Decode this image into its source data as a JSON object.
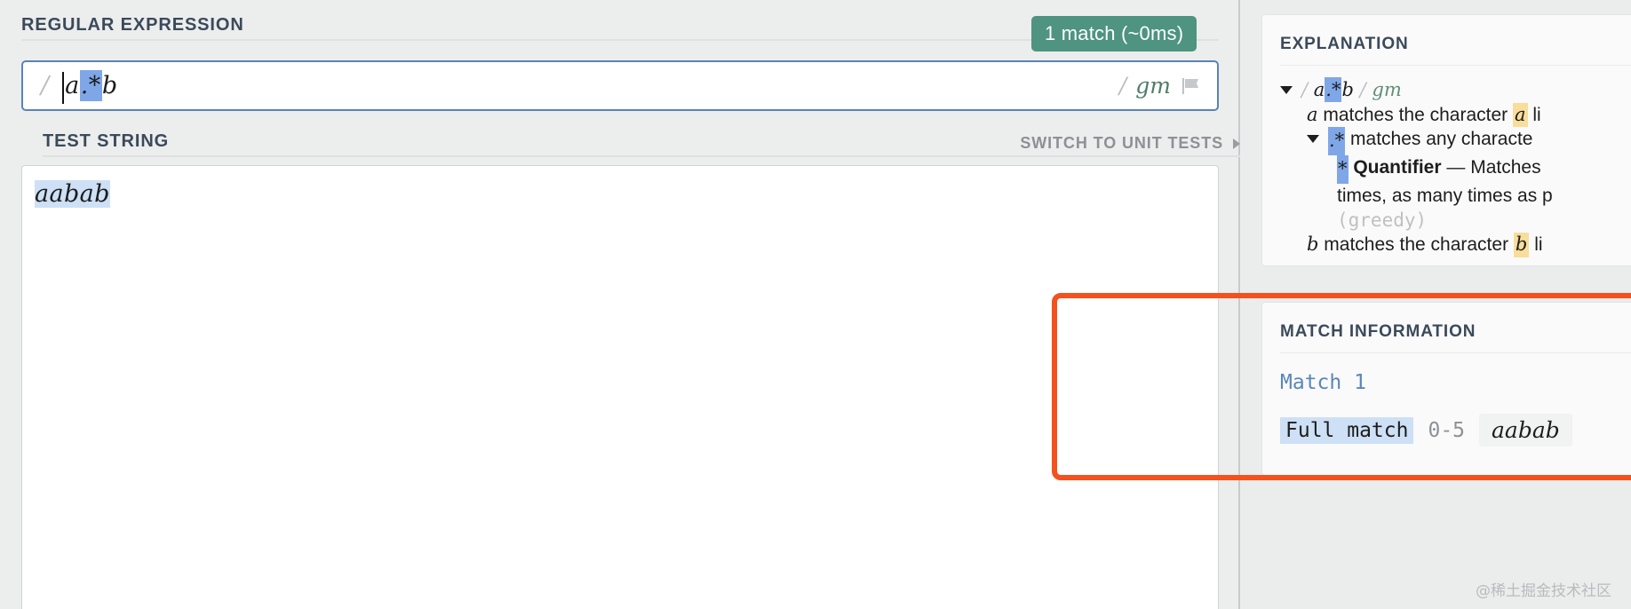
{
  "left": {
    "regex_section_title": "REGULAR EXPRESSION",
    "match_badge": "1 match (~0ms)",
    "regex": {
      "open_delim": "/",
      "prefix": "a",
      "highlighted": ".*",
      "suffix": "b",
      "close_delim": "/",
      "flags": "gm",
      "flag_icon": "flag-icon"
    },
    "test_section_title": "TEST STRING",
    "switch_link": "SWITCH TO UNIT TESTS",
    "switch_caret_icon": "caret-right-icon",
    "test_string": "aabab"
  },
  "right": {
    "explanation": {
      "title": "EXPLANATION",
      "toggle_icon": "caret-down-icon",
      "pattern": {
        "open_delim": "/",
        "prefix": "a",
        "highlighted": ".*",
        "suffix": "b",
        "close_delim": "/",
        "flags": "gm"
      },
      "lines": {
        "line_a_token": "a",
        "line_a_text": "matches the character",
        "line_a_literal": "a",
        "line_a_tail": "li",
        "line_dotstar_token": ".*",
        "line_dotstar_text": "matches any characte",
        "quantifier_token": "*",
        "quantifier_label": "Quantifier",
        "quantifier_dash": "—",
        "quantifier_text": "Matches",
        "quantifier_line2": "times, as many times as p",
        "greedy": "(greedy)",
        "line_b_token": "b",
        "line_b_text": "matches the character",
        "line_b_literal": "b",
        "line_b_tail": "li"
      }
    },
    "match_information": {
      "title": "MATCH INFORMATION",
      "match_label": "Match 1",
      "full_match_label": "Full match",
      "range": "0-5",
      "value": "aabab"
    }
  },
  "annotation": {
    "name": "orange-highlight-box",
    "color": "#f4511e"
  },
  "watermark": "@稀土掘金技术社区",
  "colors": {
    "badge_green": "#4e9480",
    "input_border_blue": "#5a83b8",
    "regex_token_highlight": "#7fa7e8",
    "match_highlight": "#cde0f5",
    "literal_highlight": "#f8de9a",
    "heading": "#3b4a5a",
    "page_bg": "#eceded"
  }
}
